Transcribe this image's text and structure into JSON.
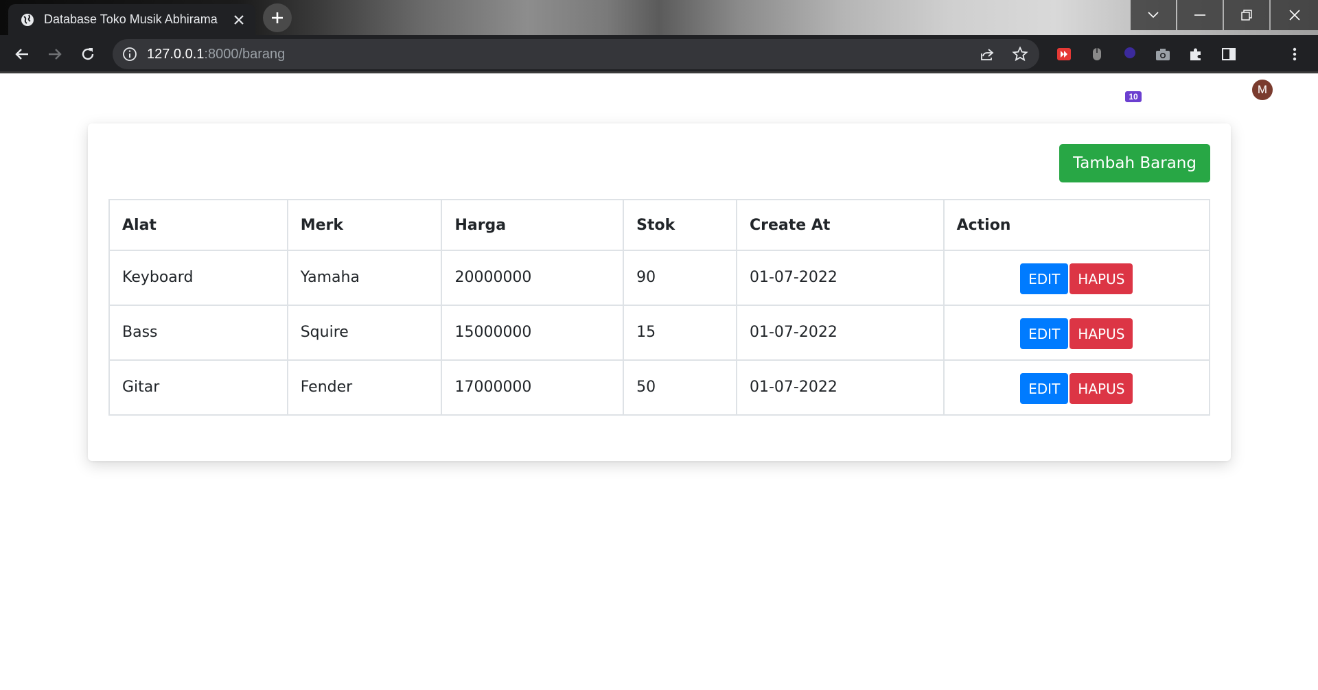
{
  "browser": {
    "tab_title": "Database Toko Musik Abhirama",
    "url_host": "127.0.0.1",
    "url_path": ":8000/barang",
    "extension_badge": "10",
    "profile_initial": "M"
  },
  "page": {
    "add_button": "Tambah Barang",
    "table": {
      "headers": [
        "Alat",
        "Merk",
        "Harga",
        "Stok",
        "Create At",
        "Action"
      ],
      "rows": [
        {
          "alat": "Keyboard",
          "merk": "Yamaha",
          "harga": "20000000",
          "stok": "90",
          "created": "01-07-2022"
        },
        {
          "alat": "Bass",
          "merk": "Squire",
          "harga": "15000000",
          "stok": "15",
          "created": "01-07-2022"
        },
        {
          "alat": "Gitar",
          "merk": "Fender",
          "harga": "17000000",
          "stok": "50",
          "created": "01-07-2022"
        }
      ],
      "edit_label": "EDIT",
      "delete_label": "HAPUS"
    }
  },
  "colors": {
    "add": "#28a745",
    "edit": "#007bff",
    "delete": "#dc3545"
  }
}
